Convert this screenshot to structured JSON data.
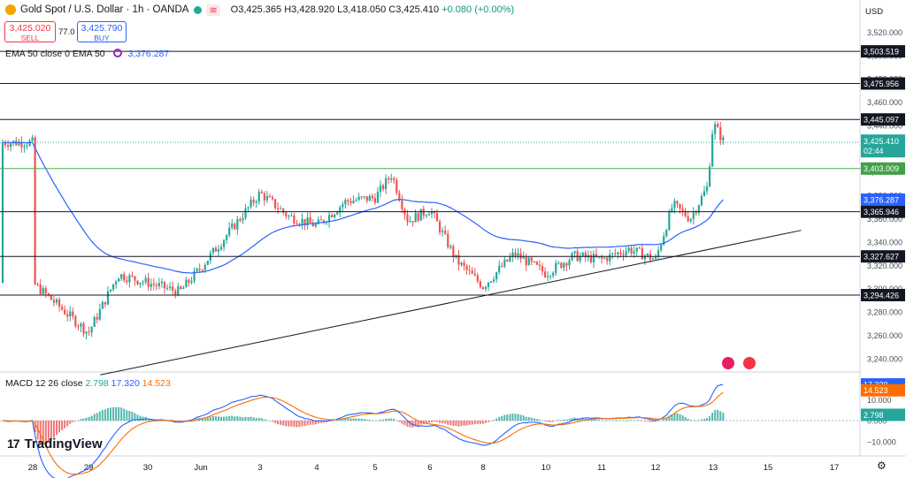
{
  "header": {
    "title": "Gold Spot / U.S. Dollar · 1h · OANDA",
    "ohlc_prefix": "O3,425.365 H3,428.920 L3,418.050 C3,425.410 ",
    "change": "+0.080 (+0.00%)"
  },
  "trade": {
    "sell_price": "3,425.020",
    "sell_label": "SELL",
    "spread": "77.0",
    "buy_price": "3,425.790",
    "buy_label": "BUY"
  },
  "ema_legend": {
    "label": "EMA 50 close 0 EMA 50",
    "value": "3,376.287"
  },
  "macd_legend": {
    "label": "MACD 12 26 close",
    "hist": "2.798",
    "macd": "17.320",
    "signal": "14.523"
  },
  "axis": {
    "currency": "USD"
  },
  "brand": "TradingView",
  "colors": {
    "up": "#26a69a",
    "down": "#ef5350",
    "ema": "#2962ff",
    "macd": "#2962ff",
    "signal": "#ff6d00",
    "level_green": "#4caf50"
  },
  "chart_data": [
    {
      "type": "candlestick",
      "title": "Gold Spot / U.S. Dollar · 1h · OANDA",
      "y_axis": {
        "min": 3230,
        "max": 3540,
        "ticks": [
          3240,
          3260,
          3280,
          3300,
          3320,
          3340,
          3360,
          3380,
          3400,
          3420,
          3440,
          3460,
          3480,
          3500,
          3520,
          3540
        ]
      },
      "x_tick_labels": [
        "28",
        "29",
        "30",
        "Jun",
        "3",
        "4",
        "5",
        "6",
        "8",
        "10",
        "11",
        "12",
        "13",
        "15",
        "17"
      ],
      "price_path": [
        {
          "day": "28",
          "price": 3305
        },
        {
          "day": "29",
          "price": 3262
        },
        {
          "day": "29.5",
          "price": 3312
        },
        {
          "day": "30",
          "price": 3305
        },
        {
          "day": "30.6",
          "price": 3297
        },
        {
          "day": "Jun",
          "price": 3318
        },
        {
          "day": "3",
          "price": 3382
        },
        {
          "day": "3.5",
          "price": 3362
        },
        {
          "day": "4",
          "price": 3354
        },
        {
          "day": "4.5",
          "price": 3375
        },
        {
          "day": "5",
          "price": 3378
        },
        {
          "day": "5.3",
          "price": 3398
        },
        {
          "day": "5.6",
          "price": 3358
        },
        {
          "day": "6",
          "price": 3368
        },
        {
          "day": "7",
          "price": 3324
        },
        {
          "day": "8",
          "price": 3302
        },
        {
          "day": "9",
          "price": 3330
        },
        {
          "day": "10",
          "price": 3313
        },
        {
          "day": "10.5",
          "price": 3328
        },
        {
          "day": "11",
          "price": 3325
        },
        {
          "day": "11.5",
          "price": 3334
        },
        {
          "day": "12",
          "price": 3325
        },
        {
          "day": "12.3",
          "price": 3372
        },
        {
          "day": "12.6",
          "price": 3360
        },
        {
          "day": "12.9",
          "price": 3387
        },
        {
          "day": "13",
          "price": 3442
        },
        {
          "day": "13.2",
          "price": 3425.41
        }
      ],
      "ema50": {
        "name": "EMA 50",
        "last": 3376.287
      },
      "price_levels": [
        {
          "label": "3,503.519",
          "value": 3503.519,
          "style": "black"
        },
        {
          "label": "3,475.956",
          "value": 3475.956,
          "style": "black"
        },
        {
          "label": "3,445.097",
          "value": 3445.097,
          "style": "black"
        },
        {
          "label": "3,403.009",
          "value": 3403.009,
          "style": "green"
        },
        {
          "label": "3,365.946",
          "value": 3365.946,
          "style": "black"
        },
        {
          "label": "3,327.627",
          "value": 3327.627,
          "style": "black"
        },
        {
          "label": "3,294.426",
          "value": 3294.426,
          "style": "black"
        }
      ],
      "current_price": {
        "label": "3,425.410",
        "countdown": "02:44",
        "value": 3425.41
      },
      "ema_tag": {
        "label": "3,376.287",
        "value": 3376.287
      },
      "trendline": {
        "from": {
          "day": "29.2",
          "price": 3226
        },
        "to": {
          "day": "15.5",
          "price": 3350
        }
      }
    },
    {
      "type": "macd",
      "name": "MACD 12 26 close",
      "y_axis": {
        "ticks": [
          -10.0,
          0.0,
          10.0
        ],
        "tick_labels": [
          "−10.000",
          "0.000",
          "10.000"
        ]
      },
      "last": {
        "histogram": 2.798,
        "macd": 17.32,
        "signal": 14.523
      },
      "tag_labels": {
        "macd": "17.320",
        "signal": "14.523",
        "histogram": "2.798"
      }
    }
  ]
}
